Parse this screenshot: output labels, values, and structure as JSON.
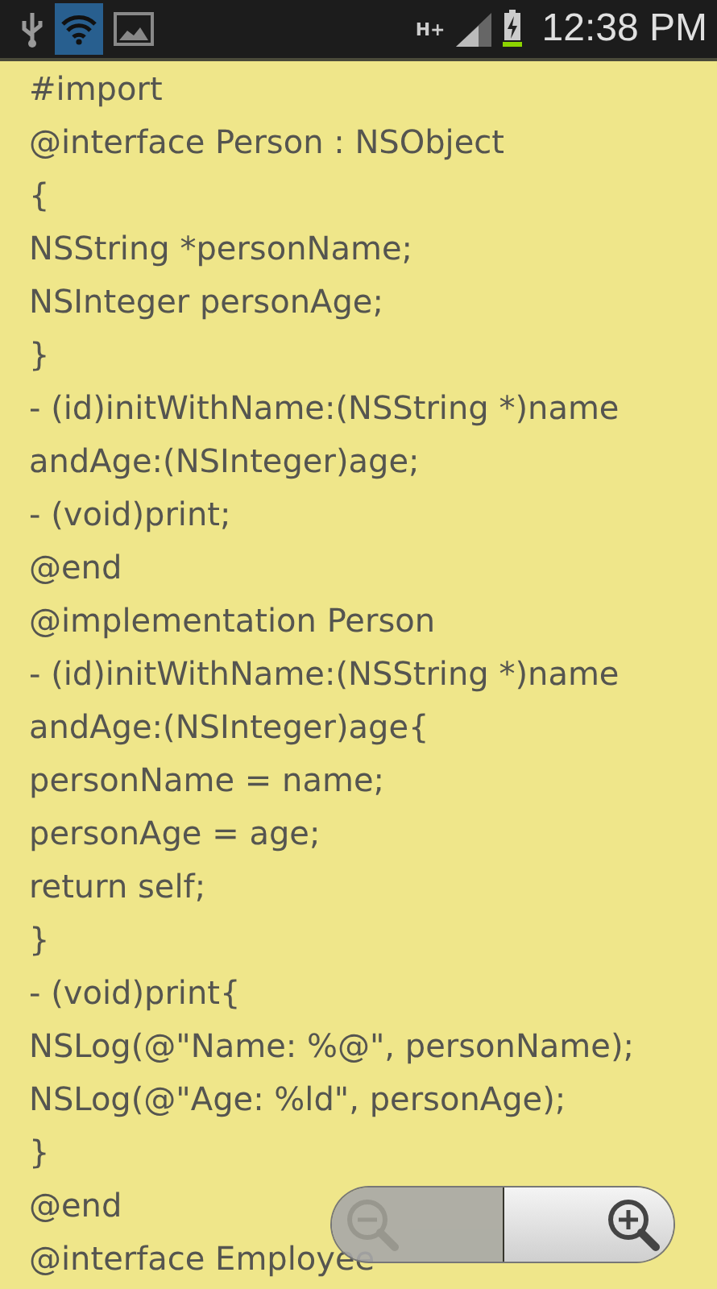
{
  "status_bar": {
    "time": "12:38 PM",
    "network": "H+",
    "wifi_selected": true
  },
  "code_lines": [
    "#import",
    "@interface Person : NSObject",
    "{",
    "NSString *personName;",
    "NSInteger personAge;",
    "}",
    "- (id)initWithName:(NSString *)name",
    "andAge:(NSInteger)age;",
    "- (void)print;",
    "@end",
    "@implementation Person",
    "- (id)initWithName:(NSString *)name",
    "andAge:(NSInteger)age{",
    "personName = name;",
    "personAge = age;",
    "return self;",
    "}",
    "- (void)print{",
    "NSLog(@\"Name: %@\", personName);",
    "NSLog(@\"Age: %ld\", personAge);",
    "}",
    "@end",
    "@interface Employee"
  ],
  "zoom_controls": {
    "zoom_out_disabled": true,
    "zoom_in_disabled": false
  }
}
